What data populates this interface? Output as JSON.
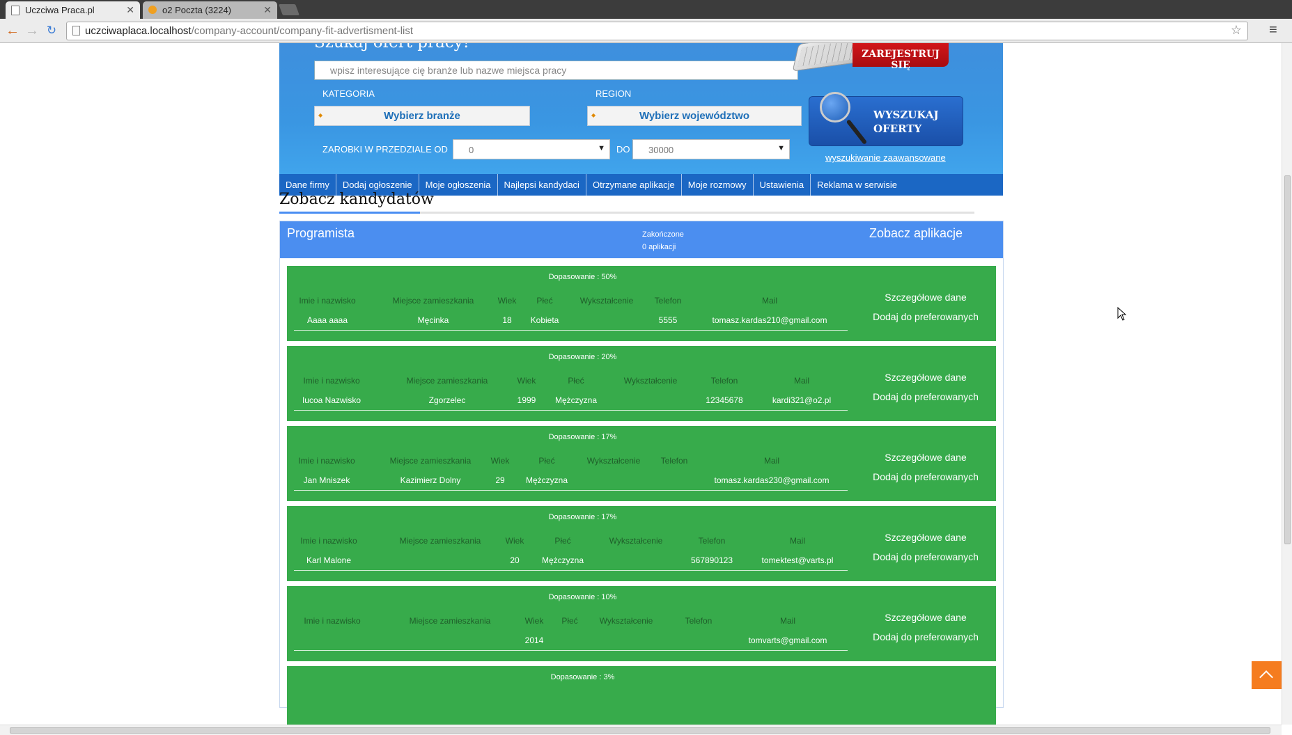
{
  "browser": {
    "tabs": [
      {
        "title": "Uczciwa Praca.pl",
        "active": true
      },
      {
        "title": "o2 Poczta (3224)",
        "active": false
      }
    ],
    "url_host": "uczciwaplaca.localhost",
    "url_path": "/company-account/company-fit-advertisment-list"
  },
  "hero": {
    "title": "Szukaj ofert pracy!",
    "search_placeholder": "wpisz interesujące cię branże lub nazwe miejsca pracy",
    "category_label": "KATEGORIA",
    "category_value": "Wybierz branże",
    "region_label": "REGION",
    "region_value": "Wybierz województwo",
    "salary_from_label": "ZAROBKI W PRZEDZIALE OD",
    "salary_from_value": "0",
    "salary_to_label": "DO",
    "salary_to_value": "30000",
    "register_label": "ZAREJESTRUJ SIĘ",
    "search_button": "WYSZUKAJ OFERTY",
    "advanced_link": "wyszukiwanie zaawansowane"
  },
  "menu": [
    "Dane firmy",
    "Dodaj ogłoszenie",
    "Moje ogłoszenia",
    "Najlepsi kandydaci",
    "Otrzymane aplikacje",
    "Moje rozmowy",
    "Ustawienia",
    "Reklama w serwisie"
  ],
  "section_title": "Zobacz kandydatów",
  "job": {
    "title": "Programista",
    "status_line1": "Zakończone",
    "status_line2": "0 aplikacji",
    "view_applications": "Zobacz aplikacje"
  },
  "column_headers": {
    "name": "Imie i nazwisko",
    "city": "Miejsce zamieszkania",
    "age": "Wiek",
    "sex": "Płeć",
    "education": "Wykształcenie",
    "phone": "Telefon",
    "mail": "Mail"
  },
  "actions": {
    "details": "Szczegółowe dane",
    "add_preferred": "Dodaj do preferowanych"
  },
  "candidates": [
    {
      "match": "Dopasowanie : 50%",
      "name": "Aaaa aaaa",
      "city": "Męcinka",
      "age": "18",
      "sex": "Kobieta",
      "education": "",
      "phone": "5555",
      "mail": "tomasz.kardas210@gmail.com"
    },
    {
      "match": "Dopasowanie : 20%",
      "name": "Iucoa Nazwisko",
      "city": "Zgorzelec",
      "age": "1999",
      "sex": "Mężczyzna",
      "education": "",
      "phone": "12345678",
      "mail": "kardi321@o2.pl"
    },
    {
      "match": "Dopasowanie : 17%",
      "name": "Jan Mniszek",
      "city": "Kazimierz Dolny",
      "age": "29",
      "sex": "Mężczyzna",
      "education": "",
      "phone": "",
      "mail": "tomasz.kardas230@gmail.com"
    },
    {
      "match": "Dopasowanie : 17%",
      "name": "Karl Malone",
      "city": "",
      "age": "20",
      "sex": "Mężczyzna",
      "education": "",
      "phone": "567890123",
      "mail": "tomektest@varts.pl"
    },
    {
      "match": "Dopasowanie : 10%",
      "name": "",
      "city": "",
      "age": "2014",
      "sex": "",
      "education": "",
      "phone": "",
      "mail": "tomvarts@gmail.com"
    },
    {
      "match": "Dopasowanie : 3%"
    }
  ]
}
